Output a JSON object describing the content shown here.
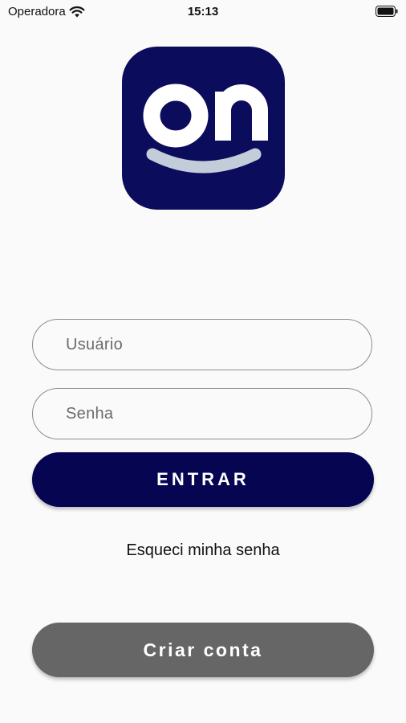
{
  "status_bar": {
    "carrier": "Operadora",
    "time": "15:13"
  },
  "logo": {
    "text": "on",
    "background_color": "#0b0c5b",
    "smile_color": "#c3cdd9"
  },
  "login_form": {
    "username_placeholder": "Usuário",
    "password_placeholder": "Senha",
    "enter_label": "ENTRAR",
    "forgot_label": "Esqueci minha senha",
    "create_label": "Criar conta"
  },
  "colors": {
    "enter_button": "#050552",
    "create_button": "#666666",
    "background": "#fafafa"
  },
  "icons": [
    "wifi-icon",
    "battery-icon"
  ]
}
